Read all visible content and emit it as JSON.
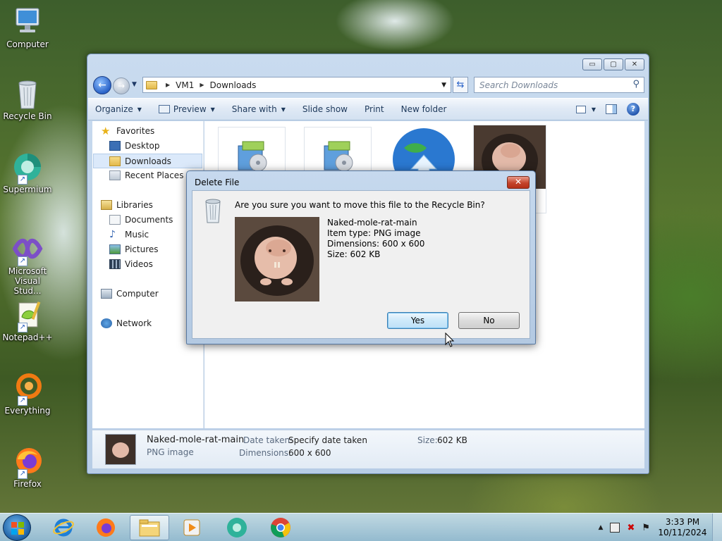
{
  "desktop": {
    "icons": [
      {
        "label": "Computer",
        "icon": "computer-icon"
      },
      {
        "label": "Recycle Bin",
        "icon": "recycle-bin-icon"
      },
      {
        "label": "Supermium",
        "icon": "supermium-icon"
      },
      {
        "label": "Microsoft Visual Stud...",
        "icon": "visual-studio-icon"
      },
      {
        "label": "Notepad++",
        "icon": "notepadpp-icon"
      },
      {
        "label": "Everything",
        "icon": "everything-icon"
      },
      {
        "label": "Firefox",
        "icon": "firefox-icon"
      }
    ]
  },
  "explorer": {
    "window_buttons": {
      "minimize": "▭",
      "maximize": "▢",
      "close": "✕"
    },
    "breadcrumb": [
      "VM1",
      "Downloads"
    ],
    "search_placeholder": "Search Downloads",
    "toolbar": {
      "organize": "Organize",
      "preview": "Preview",
      "share_with": "Share with",
      "slide_show": "Slide show",
      "print": "Print",
      "new_folder": "New folder"
    },
    "nav": {
      "favorites": "Favorites",
      "desktop": "Desktop",
      "downloads": "Downloads",
      "recent_places": "Recent Places",
      "libraries": "Libraries",
      "documents": "Documents",
      "music": "Music",
      "pictures": "Pictures",
      "videos": "Videos",
      "computer": "Computer",
      "network": "Network"
    },
    "details": {
      "name": "Naked-mole-rat-main",
      "type": "PNG image",
      "date_taken_label": "Date taken:",
      "date_taken_value": "Specify date taken",
      "dimensions_label": "Dimensions:",
      "dimensions_value": "600 x 600",
      "size_label": "Size:",
      "size_value": "602 KB"
    }
  },
  "dialog": {
    "title": "Delete File",
    "close": "✕",
    "question": "Are you sure you want to move this file to the Recycle Bin?",
    "file_name": "Naked-mole-rat-main",
    "item_type": "Item type: PNG image",
    "dimensions": "Dimensions: 600 x 600",
    "size": "Size: 602 KB",
    "yes": "Yes",
    "no": "No"
  },
  "taskbar": {
    "time": "3:33 PM",
    "date": "10/11/2024"
  },
  "colors": {
    "accent": "#2a63c8",
    "window_frame": "#c9dbef"
  }
}
